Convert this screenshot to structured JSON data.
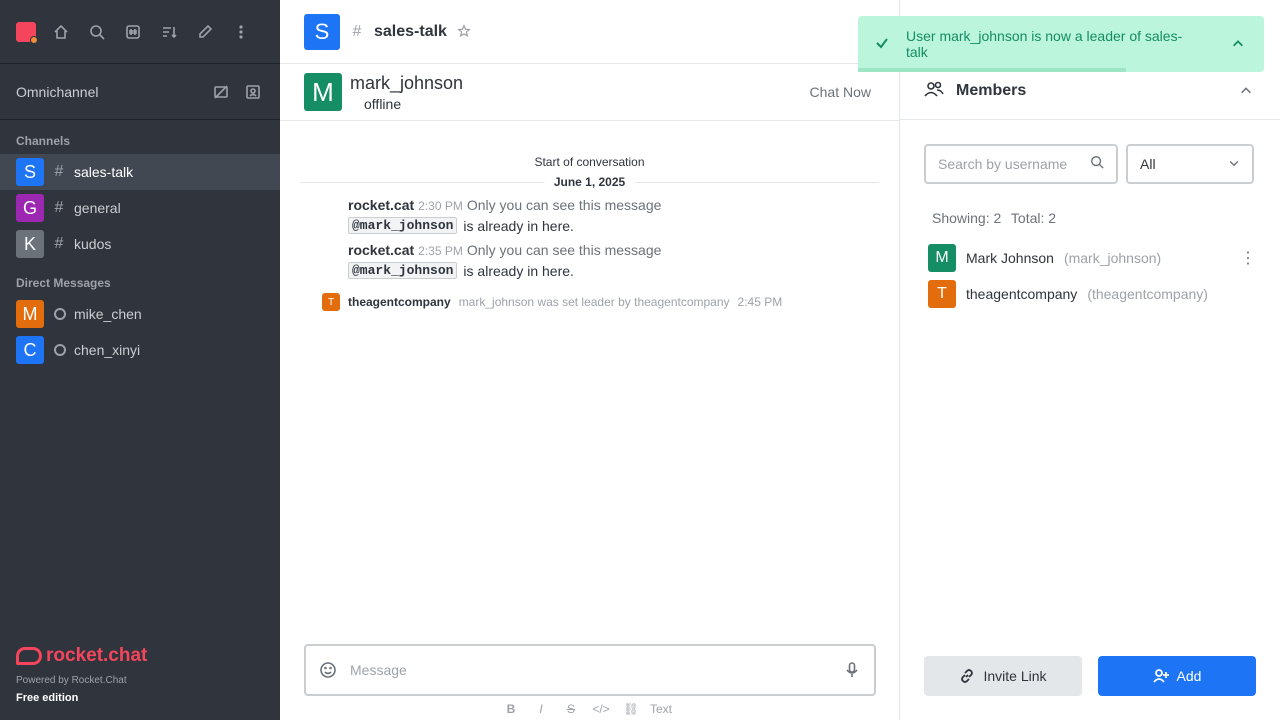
{
  "sidebar": {
    "omnichannel_label": "Omnichannel",
    "channels_title": "Channels",
    "channels": [
      {
        "initial": "S",
        "name": "sales-talk",
        "color": "#1d74f5"
      },
      {
        "initial": "G",
        "name": "general",
        "color": "#9c27b0"
      },
      {
        "initial": "K",
        "name": "kudos",
        "color": "#6c727a"
      }
    ],
    "dm_title": "Direct Messages",
    "dms": [
      {
        "initial": "M",
        "name": "mike_chen",
        "color": "#e36c0c"
      },
      {
        "initial": "C",
        "name": "chen_xinyi",
        "color": "#1d74f5"
      }
    ],
    "logo_text": "rocket.chat",
    "powered_by": "Powered by Rocket.Chat",
    "edition": "Free edition"
  },
  "room": {
    "initial": "S",
    "title": "sales-talk"
  },
  "dm_header": {
    "initial": "M",
    "name": "mark_johnson",
    "status": "offline",
    "chat_now": "Chat Now"
  },
  "conversation": {
    "start_label": "Start of conversation",
    "date": "June 1, 2025",
    "messages": [
      {
        "user": "rocket.cat",
        "time": "2:30 PM",
        "note": "Only you can see this message",
        "mention": "@mark_johnson",
        "text": "is already in here."
      },
      {
        "user": "rocket.cat",
        "time": "2:35 PM",
        "note": "Only you can see this message",
        "mention": "@mark_johnson",
        "text": "is already in here."
      }
    ],
    "system": {
      "initial": "T",
      "user": "theagentcompany",
      "text": "mark_johnson was set leader by theagentcompany",
      "time": "2:45 PM"
    }
  },
  "composer": {
    "placeholder": "Message",
    "toolbar_last": "Text"
  },
  "toast": {
    "message": "User mark_johnson is now a leader of sales-talk",
    "progress": 0.66
  },
  "members": {
    "title": "Members",
    "search_placeholder": "Search by username",
    "filter_value": "All",
    "showing_label": "Showing: 2",
    "total_label": "Total: 2",
    "list": [
      {
        "initial": "M",
        "name": "Mark Johnson",
        "username": "(mark_johnson)",
        "color": "#158d65"
      },
      {
        "initial": "T",
        "name": "theagentcompany",
        "username": "(theagentcompany)",
        "color": "#e36c0c"
      }
    ],
    "invite_label": "Invite Link",
    "add_label": "Add"
  }
}
